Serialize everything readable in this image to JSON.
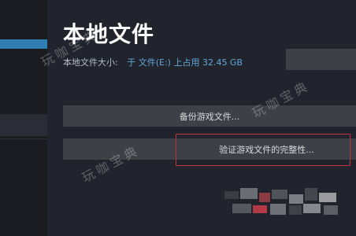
{
  "page": {
    "title": "本地文件",
    "size_label": "本地文件大小:",
    "size_value": "于 文件(E:) 上占用 32.45 GB"
  },
  "buttons": {
    "backup": "备份游戏文件...",
    "verify": "验证游戏文件的完整性..."
  },
  "watermarks": [
    "玩咖宝典",
    "玩咖宝典",
    "玩咖宝典"
  ],
  "colors": {
    "highlight_border": "#c0303a",
    "size_value_text": "#62a8d8",
    "sidebar_accent": "#2f7db3"
  }
}
